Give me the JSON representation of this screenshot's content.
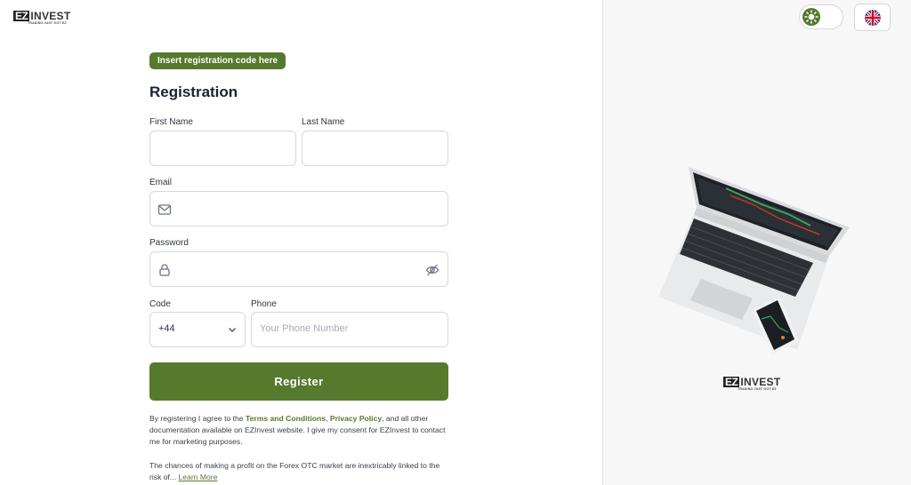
{
  "brand": {
    "ez": "EZ",
    "invest": "INVEST",
    "tagline": "TRADING JUST GOT EZ"
  },
  "registration_code_label": "Insert registration code here",
  "title": "Registration",
  "form": {
    "first_name_label": "First Name",
    "last_name_label": "Last Name",
    "email_label": "Email",
    "password_label": "Password",
    "code_label": "Code",
    "code_value": "+44",
    "phone_label": "Phone",
    "phone_placeholder": "Your Phone Number",
    "register_label": "Register"
  },
  "consent": {
    "prefix": "By registering I agree to the ",
    "terms": "Terms and Conditions",
    "sep": ", ",
    "privacy": "Privacy Policy",
    "suffix": ", and all other documentation available on EZInvest website. I give my consent for EZInvest to contact me for marketing purposes."
  },
  "risk": {
    "text": "The chances of making a profit on the Forex OTC market are inextricably linked to the risk of... ",
    "learn_more": "Learn More"
  },
  "header": {
    "theme_toggle_icon": "sun-icon",
    "language_icon": "uk-flag-icon"
  },
  "colors": {
    "accent": "#557a2e",
    "right_bg": "#f7f7f7"
  }
}
